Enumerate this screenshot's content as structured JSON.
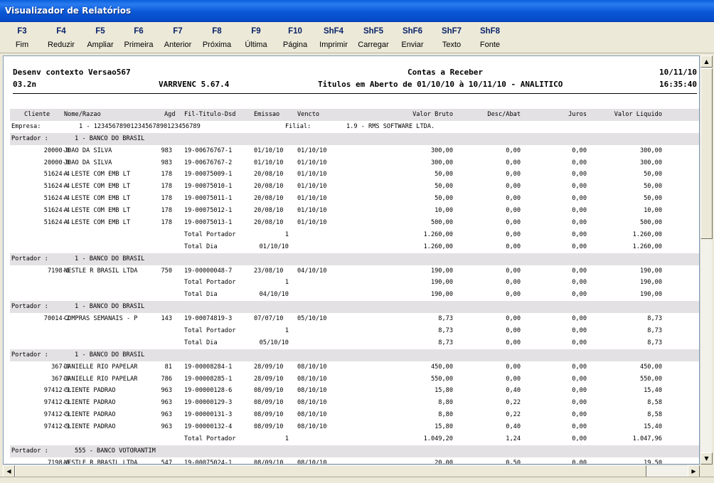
{
  "window": {
    "title": "Visualizador de Relatórios"
  },
  "toolbar": [
    {
      "key": "F3",
      "label": "Fim"
    },
    {
      "key": "F4",
      "label": "Reduzir"
    },
    {
      "key": "F5",
      "label": "Ampliar"
    },
    {
      "key": "F6",
      "label": "Primeira"
    },
    {
      "key": "F7",
      "label": "Anterior"
    },
    {
      "key": "F8",
      "label": "Próxima"
    },
    {
      "key": "F9",
      "label": "Última"
    },
    {
      "key": "F10",
      "label": "Página"
    },
    {
      "key": "ShF4",
      "label": "Imprimir"
    },
    {
      "key": "ShF5",
      "label": "Carregar"
    },
    {
      "key": "ShF6",
      "label": "Enviar"
    },
    {
      "key": "ShF7",
      "label": "Texto"
    },
    {
      "key": "ShF8",
      "label": "Fonte"
    }
  ],
  "report": {
    "header": {
      "left1": "Desenv contexto Versao567",
      "center1": "Contas a Receber",
      "date": "10/11/10",
      "left2": "03.2n",
      "program": "VARRVENC 5.67.4",
      "subtitle": "Titulos em Aberto de 01/10/10 à 10/11/10 - ANALITICO",
      "time": "16:35:40"
    },
    "columns": {
      "cliente": "Cliente",
      "nome": "Nome/Razao",
      "agd": "Agd",
      "titulo": "Fil-Titulo-Dsd",
      "emissao": "Emissao",
      "vencto": "Vencto",
      "bruto": "Valor Bruto",
      "desc": "Desc/Abat",
      "juros": "Juros",
      "liquido": "Valor Liquido"
    },
    "empresa": {
      "label": "Empresa:",
      "value": "1 - 12345678901234567890123456789",
      "filial_label": "Filial:",
      "filial_value": "1.9 - RMS SOFTWARE LTDA."
    },
    "rows": [
      {
        "t": "portador",
        "label": "Portador :",
        "value": "1 - BANCO DO BRASIL"
      },
      {
        "t": "d",
        "cliente": "20000-0",
        "nome": "JOAO DA SILVA",
        "agd": "983",
        "titulo": "19-00676767-1",
        "emissao": "01/10/10",
        "vencto": "01/10/10",
        "bruto": "300,00",
        "desc": "0,00",
        "juros": "0,00",
        "liquido": "300,00"
      },
      {
        "t": "d",
        "cliente": "20000-0",
        "nome": "JOAO DA SILVA",
        "agd": "983",
        "titulo": "19-00676767-2",
        "emissao": "01/10/10",
        "vencto": "01/10/10",
        "bruto": "300,00",
        "desc": "0,00",
        "juros": "0,00",
        "liquido": "300,00"
      },
      {
        "t": "d",
        "cliente": "51624-4",
        "nome": "A LESTE COM EMB LT",
        "agd": "178",
        "titulo": "19-00075009-1",
        "emissao": "20/08/10",
        "vencto": "01/10/10",
        "bruto": "50,00",
        "desc": "0,00",
        "juros": "0,00",
        "liquido": "50,00"
      },
      {
        "t": "d",
        "cliente": "51624-4",
        "nome": "A LESTE COM EMB LT",
        "agd": "178",
        "titulo": "19-00075010-1",
        "emissao": "20/08/10",
        "vencto": "01/10/10",
        "bruto": "50,00",
        "desc": "0,00",
        "juros": "0,00",
        "liquido": "50,00"
      },
      {
        "t": "d",
        "cliente": "51624-4",
        "nome": "A LESTE COM EMB LT",
        "agd": "178",
        "titulo": "19-00075011-1",
        "emissao": "20/08/10",
        "vencto": "01/10/10",
        "bruto": "50,00",
        "desc": "0,00",
        "juros": "0,00",
        "liquido": "50,00"
      },
      {
        "t": "d",
        "cliente": "51624-4",
        "nome": "A LESTE COM EMB LT",
        "agd": "178",
        "titulo": "19-00075012-1",
        "emissao": "20/08/10",
        "vencto": "01/10/10",
        "bruto": "10,00",
        "desc": "0,00",
        "juros": "0,00",
        "liquido": "10,00"
      },
      {
        "t": "d",
        "cliente": "51624-4",
        "nome": "A LESTE COM EMB LT",
        "agd": "178",
        "titulo": "19-00075013-1",
        "emissao": "20/08/10",
        "vencto": "01/10/10",
        "bruto": "500,00",
        "desc": "0,00",
        "juros": "0,00",
        "liquido": "500,00"
      },
      {
        "t": "tot",
        "label": "Total Portador",
        "ref": "1",
        "bruto": "1.260,00",
        "desc": "0,00",
        "juros": "0,00",
        "liquido": "1.260,00"
      },
      {
        "t": "tot",
        "label": "Total Dia",
        "ref": "01/10/10",
        "bruto": "1.260,00",
        "desc": "0,00",
        "juros": "0,00",
        "liquido": "1.260,00"
      },
      {
        "t": "portador",
        "label": "Portador :",
        "value": "1 - BANCO DO BRASIL"
      },
      {
        "t": "d",
        "cliente": "7198-6",
        "nome": "NESTLE R BRASIL LTDA",
        "agd": "750",
        "titulo": "19-00000048-7",
        "emissao": "23/08/10",
        "vencto": "04/10/10",
        "bruto": "190,00",
        "desc": "0,00",
        "juros": "0,00",
        "liquido": "190,00"
      },
      {
        "t": "tot",
        "label": "Total Portador",
        "ref": "1",
        "bruto": "190,00",
        "desc": "0,00",
        "juros": "0,00",
        "liquido": "190,00"
      },
      {
        "t": "tot",
        "label": "Total Dia",
        "ref": "04/10/10",
        "bruto": "190,00",
        "desc": "0,00",
        "juros": "0,00",
        "liquido": "190,00"
      },
      {
        "t": "portador",
        "label": "Portador :",
        "value": "1 - BANCO DO BRASIL"
      },
      {
        "t": "d",
        "cliente": "70014-2",
        "nome": "COMPRAS SEMANAIS - P",
        "agd": "143",
        "titulo": "19-00074819-3",
        "emissao": "07/07/10",
        "vencto": "05/10/10",
        "bruto": "8,73",
        "desc": "0,00",
        "juros": "0,00",
        "liquido": "8,73"
      },
      {
        "t": "tot",
        "label": "Total Portador",
        "ref": "1",
        "bruto": "8,73",
        "desc": "0,00",
        "juros": "0,00",
        "liquido": "8,73"
      },
      {
        "t": "tot",
        "label": "Total Dia",
        "ref": "05/10/10",
        "bruto": "8,73",
        "desc": "0,00",
        "juros": "0,00",
        "liquido": "8,73"
      },
      {
        "t": "portador",
        "label": "Portador :",
        "value": "1 - BANCO DO BRASIL"
      },
      {
        "t": "d",
        "cliente": "367-0",
        "nome": "DANIELLE RIO PAPELAR",
        "agd": "81",
        "titulo": "19-00008284-1",
        "emissao": "28/09/10",
        "vencto": "08/10/10",
        "bruto": "450,00",
        "desc": "0,00",
        "juros": "0,00",
        "liquido": "450,00"
      },
      {
        "t": "d",
        "cliente": "367-0",
        "nome": "DANIELLE RIO PAPELAR",
        "agd": "786",
        "titulo": "19-00008285-1",
        "emissao": "28/09/10",
        "vencto": "08/10/10",
        "bruto": "550,00",
        "desc": "0,00",
        "juros": "0,00",
        "liquido": "550,00"
      },
      {
        "t": "d",
        "cliente": "97412-9",
        "nome": "CLIENTE PADRAO",
        "agd": "963",
        "titulo": "19-00000128-6",
        "emissao": "08/09/10",
        "vencto": "08/10/10",
        "bruto": "15,80",
        "desc": "0,40",
        "juros": "0,00",
        "liquido": "15,40"
      },
      {
        "t": "d",
        "cliente": "97412-9",
        "nome": "CLIENTE PADRAO",
        "agd": "963",
        "titulo": "19-00000129-3",
        "emissao": "08/09/10",
        "vencto": "08/10/10",
        "bruto": "8,80",
        "desc": "0,22",
        "juros": "0,00",
        "liquido": "8,58"
      },
      {
        "t": "d",
        "cliente": "97412-9",
        "nome": "CLIENTE PADRAO",
        "agd": "963",
        "titulo": "19-00000131-3",
        "emissao": "08/09/10",
        "vencto": "08/10/10",
        "bruto": "8,80",
        "desc": "0,22",
        "juros": "0,00",
        "liquido": "8,58"
      },
      {
        "t": "d",
        "cliente": "97412-9",
        "nome": "CLIENTE PADRAO",
        "agd": "963",
        "titulo": "19-00000132-4",
        "emissao": "08/09/10",
        "vencto": "08/10/10",
        "bruto": "15,80",
        "desc": "0,40",
        "juros": "0,00",
        "liquido": "15,40"
      },
      {
        "t": "tot",
        "label": "Total Portador",
        "ref": "1",
        "bruto": "1.049,20",
        "desc": "1,24",
        "juros": "0,00",
        "liquido": "1.047,96"
      },
      {
        "t": "portador",
        "label": "Portador :",
        "value": "555 - BANCO VOTORANTIM"
      },
      {
        "t": "d",
        "cliente": "7198-6",
        "nome": "NESTLE R BRASIL LTDA",
        "agd": "547",
        "titulo": "19-00075024-1",
        "emissao": "08/09/10",
        "vencto": "08/10/10",
        "bruto": "20,00",
        "desc": "0,50",
        "juros": "0,00",
        "liquido": "19,50"
      }
    ]
  }
}
